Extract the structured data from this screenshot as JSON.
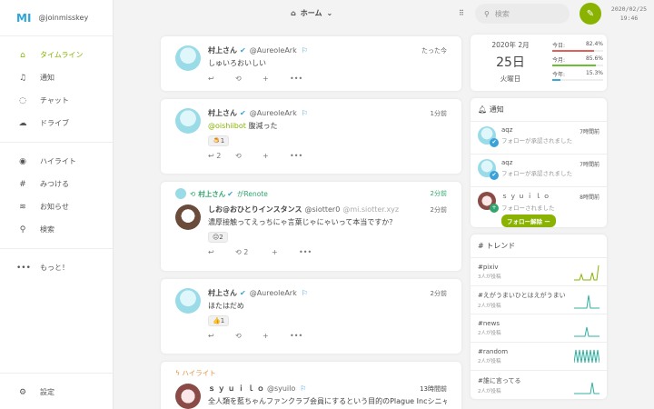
{
  "account": {
    "logo": "MI",
    "handle": "@joinmisskey"
  },
  "nav": {
    "items": [
      {
        "icon": "home-icon",
        "glyph": "⌂",
        "label": "タイムライン",
        "active": true
      },
      {
        "icon": "bell-icon",
        "glyph": "♫",
        "label": "通知"
      },
      {
        "icon": "chat-icon",
        "glyph": "◌",
        "label": "チャット"
      },
      {
        "icon": "cloud-icon",
        "glyph": "☁",
        "label": "ドライブ"
      }
    ],
    "items2": [
      {
        "icon": "fire-icon",
        "glyph": "◉",
        "label": "ハイライト"
      },
      {
        "icon": "hash-icon",
        "glyph": "#",
        "label": "みつける"
      },
      {
        "icon": "broadcast-icon",
        "glyph": "📡",
        "label": "お知らせ"
      },
      {
        "icon": "search-icon",
        "glyph": "⚲",
        "label": "検索"
      }
    ],
    "more": "もっと！",
    "settings": "設定"
  },
  "header": {
    "title": "ホーム",
    "search_placeholder": "検索",
    "clock_date": "2020/02/25",
    "clock_time": "19:46"
  },
  "notes": [
    {
      "name": "村上さん",
      "acct": "@AureoleArk",
      "host": "",
      "time": "たった今",
      "text": "しゅいろおいしい",
      "reaction": "",
      "renote_count": "",
      "reply_count": ""
    },
    {
      "name": "村上さん",
      "acct": "@AureoleArk",
      "host": "",
      "time": "1分前",
      "mention": "@oishiibot",
      "text": " 腹減った",
      "reaction": "🍮1",
      "reply_count": "2"
    },
    {
      "renoted_by": "村上さん",
      "renote_suffix": "がRenote",
      "renote_time": "2分前",
      "name": "しお@おひとりインスタンス",
      "acct": "@siotter0",
      "host": "@mi.siotter.xyz",
      "time": "2分前",
      "text": "濃厚接触ってえっちにゃ言葉じゃにゃいって本当ですか？",
      "reaction": "😑2",
      "renote_count": "2"
    },
    {
      "name": "村上さん",
      "acct": "@AureoleArk",
      "host": "",
      "time": "2分前",
      "text": "ほたはだめ",
      "reaction": "👍1"
    },
    {
      "highlight_label": "ハイライト",
      "name": "ｓ ｙ ｕ ｉ ｌ ｏ",
      "acct": "@syuilo",
      "host": "",
      "time": "13時間前",
      "text": "全人類を藍ちゃんファンクラブ会員にするという目的のPlague Incシニャ"
    }
  ],
  "calendar": {
    "year_month": "2020年 2月",
    "day": "25日",
    "weekday": "火曜日",
    "bars": [
      {
        "label": "今日:",
        "value": "82.4%",
        "ratio": 0.824,
        "color": "#e0605a"
      },
      {
        "label": "今月:",
        "value": "85.6%",
        "ratio": 0.856,
        "color": "#6abf35"
      },
      {
        "label": "今年:",
        "value": "15.3%",
        "ratio": 0.153,
        "color": "#3aa9d9"
      }
    ]
  },
  "notifications": {
    "title": "通知",
    "items": [
      {
        "user": "aqz",
        "text": "フォローが承認されました",
        "time": "7時間前"
      },
      {
        "user": "aqz",
        "text": "フォローが承認されました",
        "time": "7時間前"
      },
      {
        "user": "ｓ ｙ ｕ ｉ ｌ ｏ",
        "text": "フォローされました",
        "time": "8時間前",
        "button": "フォロー解除 ー"
      }
    ]
  },
  "trends": {
    "title": "トレンド",
    "items": [
      {
        "tag": "#pixiv",
        "count": "3人が投稿"
      },
      {
        "tag": "#えがうまいひとはえがうまい",
        "count": "2人が投稿"
      },
      {
        "tag": "#news",
        "count": "2人が投稿"
      },
      {
        "tag": "#random",
        "count": "2人が投稿"
      },
      {
        "tag": "#誰に言ってる",
        "count": "2人が投稿"
      }
    ]
  },
  "colors": {
    "accent": "#86b300",
    "renote": "#30a56e",
    "link": "#3aa2d9"
  }
}
